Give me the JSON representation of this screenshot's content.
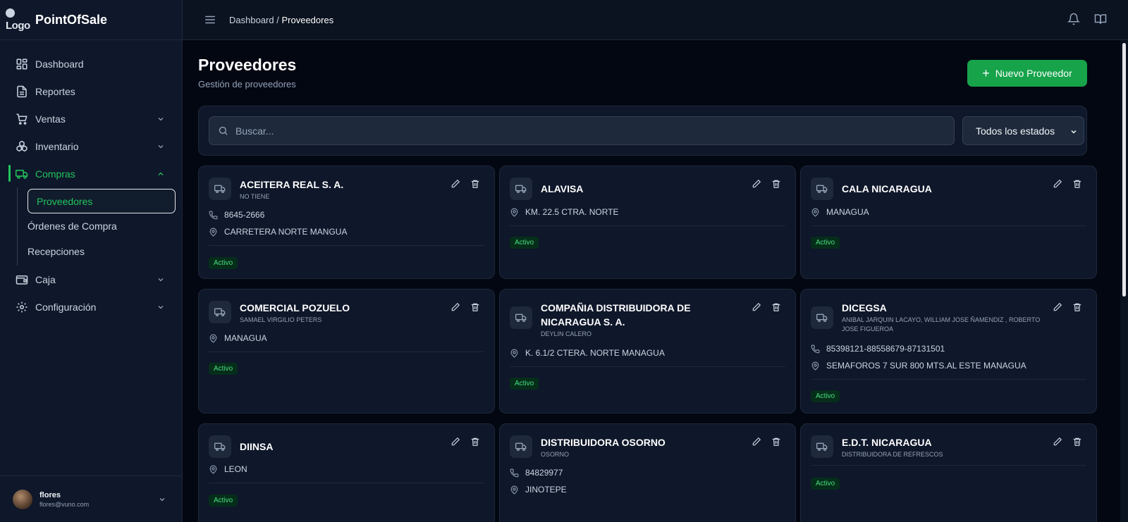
{
  "brand": {
    "logo_text": "Logo",
    "name": "PointOfSale"
  },
  "sidebar": {
    "items": [
      {
        "label": "Dashboard"
      },
      {
        "label": "Reportes"
      },
      {
        "label": "Ventas"
      },
      {
        "label": "Inventario"
      },
      {
        "label": "Compras"
      },
      {
        "label": "Caja"
      },
      {
        "label": "Configuración"
      }
    ],
    "compras_sub": [
      "Proveedores",
      "Órdenes de Compra",
      "Recepciones"
    ],
    "user": {
      "name": "flores",
      "email": "flores@vuno.com"
    }
  },
  "topbar": {
    "crumb_root": "Dashboard",
    "crumb_sep": "/",
    "crumb_current": "Proveedores"
  },
  "page": {
    "title": "Proveedores",
    "subtitle": "Gestión de proveedores",
    "new_button": "Nuevo Proveedor",
    "search_placeholder": "Buscar...",
    "status_filter": "Todos los estados"
  },
  "providers": [
    {
      "name": "ACEITERA REAL S. A.",
      "contact": "NO TIENE",
      "phone": "8645-2666",
      "address": "CARRETERA NORTE MANGUA",
      "status": "Activo"
    },
    {
      "name": "ALAVISA",
      "contact": "",
      "phone": "",
      "address": "KM. 22.5 CTRA. NORTE",
      "status": "Activo"
    },
    {
      "name": "CALA NICARAGUA",
      "contact": "",
      "phone": "",
      "address": "MANAGUA",
      "status": "Activo"
    },
    {
      "name": "COMERCIAL POZUELO",
      "contact": "SAMAEL VIRGILIO PETERS",
      "phone": "",
      "address": "MANAGUA",
      "status": "Activo"
    },
    {
      "name": "COMPAÑIA DISTRIBUIDORA DE NICARAGUA S. A.",
      "contact": "DEYLIN CALERO",
      "phone": "",
      "address": "K. 6.1/2 CTERA. NORTE MANAGUA",
      "status": "Activo"
    },
    {
      "name": "DICEGSA",
      "contact": "ANIBAL JARQUIN LACAYO, WILLIAM JOSE ÑAMENDIZ , ROBERTO JOSE FIGUEROA",
      "phone": "85398121-88558679-87131501",
      "address": "SEMAFOROS 7 SUR 800 MTS.AL ESTE MANAGUA",
      "status": "Activo"
    },
    {
      "name": "DIINSA",
      "contact": "",
      "phone": "",
      "address": "LEON",
      "status": "Activo"
    },
    {
      "name": "DISTRIBUIDORA OSORNO",
      "contact": "OSORNO",
      "phone": "84829977",
      "address": "JINOTEPE",
      "status": ""
    },
    {
      "name": "E.D.T. NICARAGUA",
      "contact": "DISTRIBUIDORA DE REFRESCOS",
      "phone": "",
      "address": "",
      "status": "Activo"
    }
  ]
}
